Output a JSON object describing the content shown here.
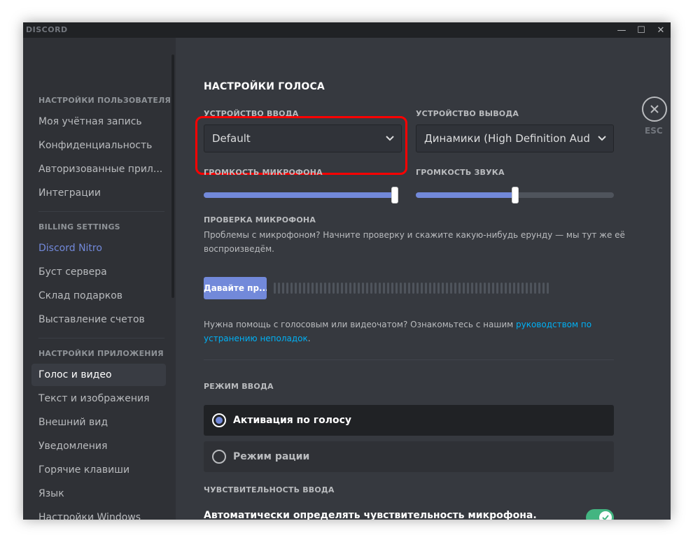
{
  "window": {
    "title": "DISCORD",
    "controls": {
      "minimize": "—",
      "maximize": "☐",
      "close": "✕"
    }
  },
  "sidebar": {
    "user_settings_header": "НАСТРОЙКИ ПОЛЬЗОВАТЕЛЯ",
    "user_items": [
      "Моя учётная запись",
      "Конфиденциальность",
      "Авторизованные прил...",
      "Интеграции"
    ],
    "billing_header": "BILLING SETTINGS",
    "billing_items": [
      "Discord Nitro",
      "Буст сервера",
      "Склад подарков",
      "Выставление счетов"
    ],
    "app_settings_header": "НАСТРОЙКИ ПРИЛОЖЕНИЯ",
    "app_items": [
      "Голос и видео",
      "Текст и изображения",
      "Внешний вид",
      "Уведомления",
      "Горячие клавиши",
      "Язык",
      "Настройки Windows"
    ],
    "active_item": "Голос и видео"
  },
  "voice": {
    "title": "НАСТРОЙКИ ГОЛОСА",
    "input_device_label": "УСТРОЙСТВО ВВОДА",
    "input_device_value": "Default",
    "output_device_label": "УСТРОЙСТВО ВЫВОДА",
    "output_device_value": "Динамики (High Definition Audio Device)",
    "mic_volume_label": "ГРОМКОСТЬ МИКРОФОНА",
    "mic_volume_fraction": 1.0,
    "output_volume_label": "ГРОМКОСТЬ ЗВУКА",
    "output_volume_fraction": 0.5,
    "mic_test_label": "ПРОВЕРКА МИКРОФОНА",
    "mic_test_desc_1": "Проблемы с микрофоном? Начните проверку и скажите какую-нибудь ерунду — мы тут же её",
    "mic_test_desc_2": "воспроизведём.",
    "mic_test_button": "Давайте пр...",
    "help_text": "Нужна помощь с голосовым или видеочатом? Ознакомьтесь с нашим ",
    "help_link_1": "руководством по",
    "help_link_2": "устранению неполадок",
    "help_end": ".",
    "input_mode_label": "РЕЖИМ ВВОДА",
    "input_mode_voice": "Активация по голосу",
    "input_mode_ptt": "Режим рации",
    "sensitivity_label": "ЧУВСТВИТЕЛЬНОСТЬ ВВОДА",
    "auto_sensitivity": "Автоматически определять чувствительность микрофона.",
    "auto_sensitivity_on": true
  },
  "close": {
    "esc_label": "ESC"
  },
  "colors": {
    "accent": "#7289da",
    "toggle_on": "#43b581",
    "highlight": "#ff0000",
    "link": "#00b0f4"
  }
}
